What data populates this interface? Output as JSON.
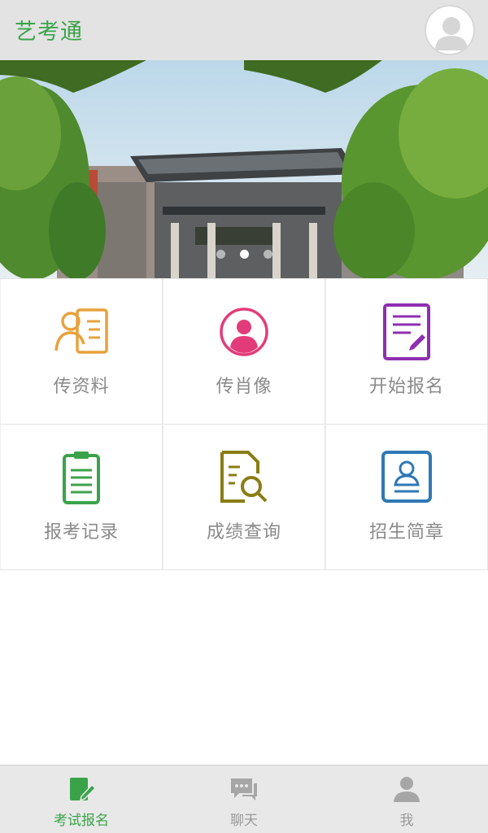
{
  "header": {
    "title": "艺考通",
    "avatar_icon": "user-avatar-icon"
  },
  "banner": {
    "slide_count": 3,
    "active_slide": 2
  },
  "grid": {
    "items": [
      {
        "label": "传资料",
        "icon": "profile-card-icon",
        "color": "#e8a23c"
      },
      {
        "label": "传肖像",
        "icon": "portrait-icon",
        "color": "#e33b79"
      },
      {
        "label": "开始报名",
        "icon": "edit-document-icon",
        "color": "#8e2fb0"
      },
      {
        "label": "报考记录",
        "icon": "clipboard-icon",
        "color": "#3aa34a"
      },
      {
        "label": "成绩查询",
        "icon": "document-search-icon",
        "color": "#8a7d12"
      },
      {
        "label": "招生简章",
        "icon": "id-card-icon",
        "color": "#2f78b6"
      }
    ]
  },
  "bottom_nav": {
    "items": [
      {
        "label": "考试报名",
        "icon": "edit-note-icon",
        "active": true
      },
      {
        "label": "聊天",
        "icon": "chat-icon",
        "active": false
      },
      {
        "label": "我",
        "icon": "person-icon",
        "active": false
      }
    ],
    "active_color": "#3aa34a",
    "inactive_color": "#9a9a9a"
  }
}
